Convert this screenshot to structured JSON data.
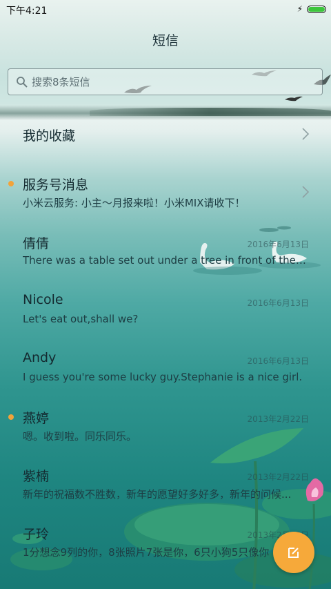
{
  "status": {
    "time": "下午4:21"
  },
  "header": {
    "title": "短信"
  },
  "search": {
    "placeholder": "搜索8条短信"
  },
  "favorites": {
    "label": "我的收藏"
  },
  "conversations": [
    {
      "name": "服务号消息",
      "preview": "小米云服务: 小主～月报来啦！小米MIX请收下！",
      "date": "",
      "unread": true,
      "chevron": true
    },
    {
      "name": "倩倩",
      "preview": "There was a table set out under a tree in front of the ho...",
      "date": "2016年6月13日",
      "unread": false
    },
    {
      "name": "Nicole",
      "preview": "Let's eat out,shall we?",
      "date": "2016年6月13日",
      "unread": false
    },
    {
      "name": "Andy",
      "preview": "I guess you're some lucky guy.Stephanie is a nice girl.",
      "date": "2016年6月13日",
      "unread": false
    },
    {
      "name": "燕婷",
      "preview": "嗯。收到啦。同乐同乐。",
      "date": "2013年2月22日",
      "unread": true
    },
    {
      "name": "紫楠",
      "preview": "新年的祝福数不胜数，新年的愿望好多好多，新年的问候...",
      "date": "2013年2月22日",
      "unread": false
    },
    {
      "name": "子玲",
      "preview": "1分想念9列的你，8张照片7张是你，6只小狗5只像你",
      "date": "2013年2月22日",
      "unread": false
    }
  ],
  "colors": {
    "accent": "#f6a93a",
    "unread_dot": "#f2a33a",
    "battery": "#3cc63c"
  }
}
